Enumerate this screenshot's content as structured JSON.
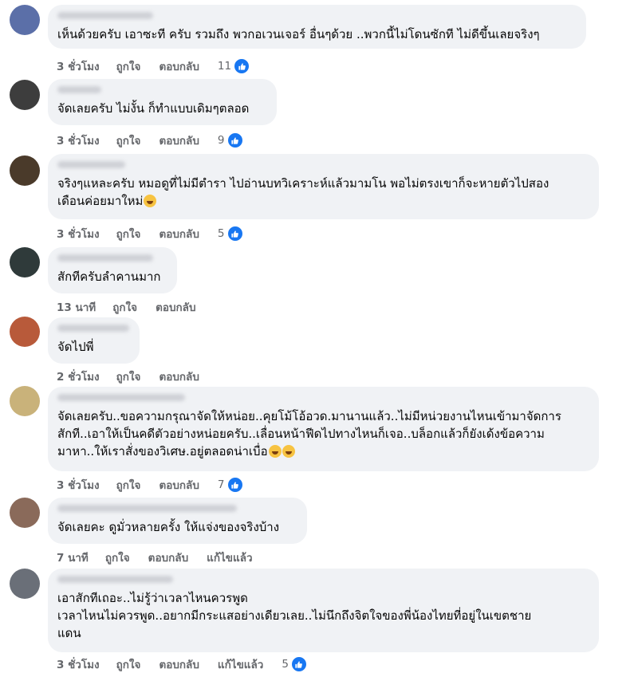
{
  "colors": {
    "bubble_bg": "#f0f2f5",
    "meta_text": "#65676b",
    "like_blue": "#1877f2",
    "body_text": "#050505"
  },
  "comments": [
    {
      "avatar_color": "#5b6fa8",
      "lines": [
        "เห็นด้วยครับ เอาซะที ครับ รวมถึง พวกอเวนเจอร์ อื่นๆด้วย ..พวกนี้ไม่โดนซักที ไม่ดีขึ้นเลยจริงๆ"
      ],
      "time": "3 ชั่วโมง",
      "like": "ถูกใจ",
      "reply": "ตอบกลับ",
      "edited": "",
      "reactions": "11"
    },
    {
      "avatar_color": "#3d3d3d",
      "lines": [
        "จัดเลยครับ ไม่งั้น ก็ทำแบบเดิมๆตลอด"
      ],
      "time": "3 ชั่วโมง",
      "like": "ถูกใจ",
      "reply": "ตอบกลับ",
      "edited": "",
      "reactions": "9"
    },
    {
      "avatar_color": "#4a3a2a",
      "lines": [
        "จริงๆแหละครับ หมอดูที่ไม่มีตำรา ไปอ่านบทวิเคราะห์แล้วมามโน พอไม่ตรงเขาก็จะหายตัวไปสอง",
        "เดือนค่อยมาใหม่"
      ],
      "emoji_count": 1,
      "time": "3 ชั่วโมง",
      "like": "ถูกใจ",
      "reply": "ตอบกลับ",
      "edited": "",
      "reactions": "5"
    },
    {
      "avatar_color": "#2f3a3a",
      "lines": [
        "สักทีครับลำคานมาก"
      ],
      "time": "13 นาที",
      "like": "ถูกใจ",
      "reply": "ตอบกลับ",
      "edited": "",
      "reactions": ""
    },
    {
      "avatar_color": "#b85a3a",
      "lines": [
        "จัดไปพี่"
      ],
      "time": "2 ชั่วโมง",
      "like": "ถูกใจ",
      "reply": "ตอบกลับ",
      "edited": "",
      "reactions": ""
    },
    {
      "avatar_color": "#c9b27a",
      "lines": [
        "จัดเลยครับ..ขอความกรุณาจัดให้หน่อย..คุยโม้โอ้อวด.มานานแล้ว..ไม่มีหน่วยงานไหนเข้ามาจัดการ",
        "สักที..เอาให้เป็นคดีตัวอย่างหน่อยครับ..เลื่อนหน้าฟีดไปทางไหนก็เจอ..บล็อกแล้วก็ยังเด้งข้อความ",
        "มาหา..ให้เราสั่งของวิเศษ.อยู่ตลอดน่าเบื่อ"
      ],
      "emoji_count": 2,
      "time": "3 ชั่วโมง",
      "like": "ถูกใจ",
      "reply": "ตอบกลับ",
      "edited": "",
      "reactions": "7"
    },
    {
      "avatar_color": "#8a6a5a",
      "lines": [
        "จัดเลยคะ ดูมั่วหลายครั้ง ให้แจ่งของจริงบ้าง"
      ],
      "time": "7 นาที",
      "like": "ถูกใจ",
      "reply": "ตอบกลับ",
      "edited": "แก้ไขแล้ว",
      "reactions": ""
    },
    {
      "avatar_color": "#6a6f78",
      "lines": [
        "เอาสักทีเถอะ..ไม่รู้ว่าเวลาไหนควรพูด",
        "เวลาไหนไม่ควรพูด..อยากมีกระแสอย่างเดียวเลย..ไม่นึกถึงจิตใจของพี่น้องไทยที่อยู่ในเขตชาย",
        "แดน"
      ],
      "time": "3 ชั่วโมง",
      "like": "ถูกใจ",
      "reply": "ตอบกลับ",
      "edited": "แก้ไขแล้ว",
      "reactions": "5"
    }
  ]
}
